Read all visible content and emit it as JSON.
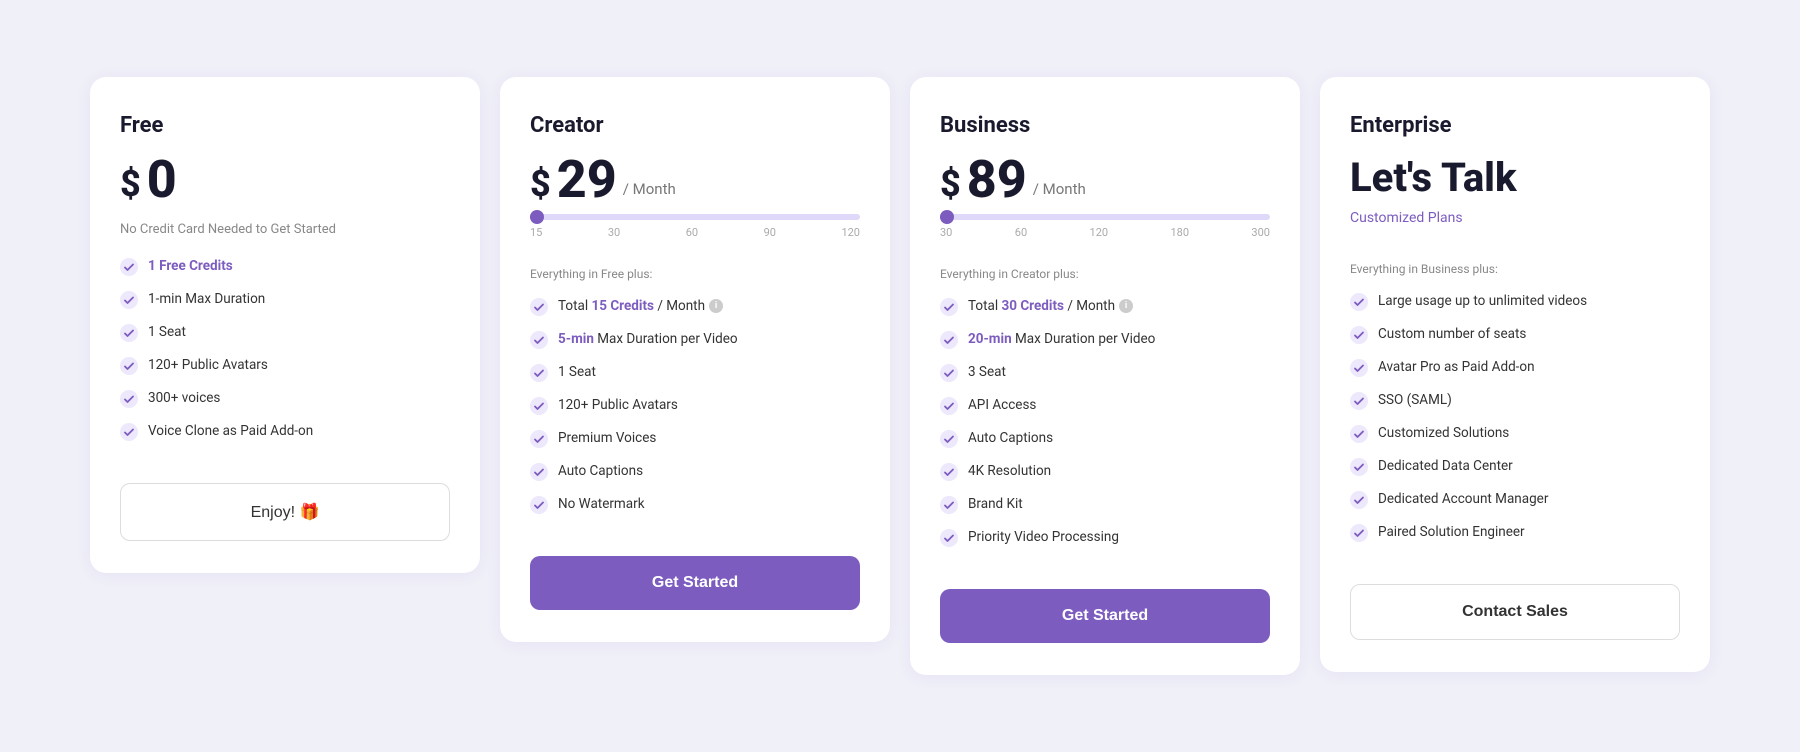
{
  "plans": [
    {
      "id": "free",
      "name": "Free",
      "price_symbol": "$",
      "price": "0",
      "price_period": null,
      "price_subtitle": "No Credit Card Needed to Get Started",
      "has_slider": false,
      "everything_label": null,
      "features": [
        {
          "text": "1 Free Credits",
          "highlight": "1 Free Credits"
        },
        {
          "text": "1-min Max Duration"
        },
        {
          "text": "1 Seat"
        },
        {
          "text": "120+ Public Avatars"
        },
        {
          "text": "300+ voices"
        },
        {
          "text": "Voice Clone as Paid Add-on"
        }
      ],
      "cta_label": "Enjoy! 🎁",
      "cta_type": "outline"
    },
    {
      "id": "creator",
      "name": "Creator",
      "price_symbol": "$",
      "price": "29",
      "price_period": "/ Month",
      "price_subtitle": null,
      "has_slider": true,
      "slider_fill_pct": 2,
      "slider_thumb_pct": 2,
      "slider_labels": [
        "15",
        "30",
        "60",
        "90",
        "120"
      ],
      "everything_label": "Everything in Free plus:",
      "features": [
        {
          "text": "Total 15 Credits / Month",
          "highlight": "15 Credits",
          "has_info": true
        },
        {
          "text": "5-min Max Duration per Video",
          "highlight": "5-min"
        },
        {
          "text": "1 Seat"
        },
        {
          "text": "120+ Public Avatars"
        },
        {
          "text": "Premium Voices"
        },
        {
          "text": "Auto Captions"
        },
        {
          "text": "No Watermark"
        }
      ],
      "cta_label": "Get Started",
      "cta_type": "primary"
    },
    {
      "id": "business",
      "name": "Business",
      "price_symbol": "$",
      "price": "89",
      "price_period": "/ Month",
      "price_subtitle": null,
      "has_slider": true,
      "slider_fill_pct": 2,
      "slider_thumb_pct": 2,
      "slider_labels": [
        "30",
        "60",
        "120",
        "180",
        "300"
      ],
      "everything_label": "Everything in Creator plus:",
      "features": [
        {
          "text": "Total 30 Credits / Month",
          "highlight": "30 Credits",
          "has_info": true
        },
        {
          "text": "20-min Max Duration per Video",
          "highlight": "20-min"
        },
        {
          "text": "3 Seat"
        },
        {
          "text": "API Access"
        },
        {
          "text": "Auto Captions"
        },
        {
          "text": "4K Resolution"
        },
        {
          "text": "Brand Kit"
        },
        {
          "text": "Priority Video Processing"
        }
      ],
      "cta_label": "Get Started",
      "cta_type": "primary"
    },
    {
      "id": "enterprise",
      "name": "Enterprise",
      "price_special": "Let's Talk",
      "price_subtitle": "Customized Plans",
      "has_slider": false,
      "everything_label": "Everything in Business plus:",
      "features": [
        {
          "text": "Large usage up to unlimited videos"
        },
        {
          "text": "Custom number of seats"
        },
        {
          "text": "Avatar Pro as Paid Add-on"
        },
        {
          "text": "SSO (SAML)"
        },
        {
          "text": "Customized Solutions"
        },
        {
          "text": "Dedicated Data Center"
        },
        {
          "text": "Dedicated Account Manager"
        },
        {
          "text": "Paired Solution Engineer"
        }
      ],
      "cta_label": "Contact Sales",
      "cta_type": "outline"
    }
  ],
  "check_color": "#7c5cbf",
  "accent_color": "#7c5cbf"
}
